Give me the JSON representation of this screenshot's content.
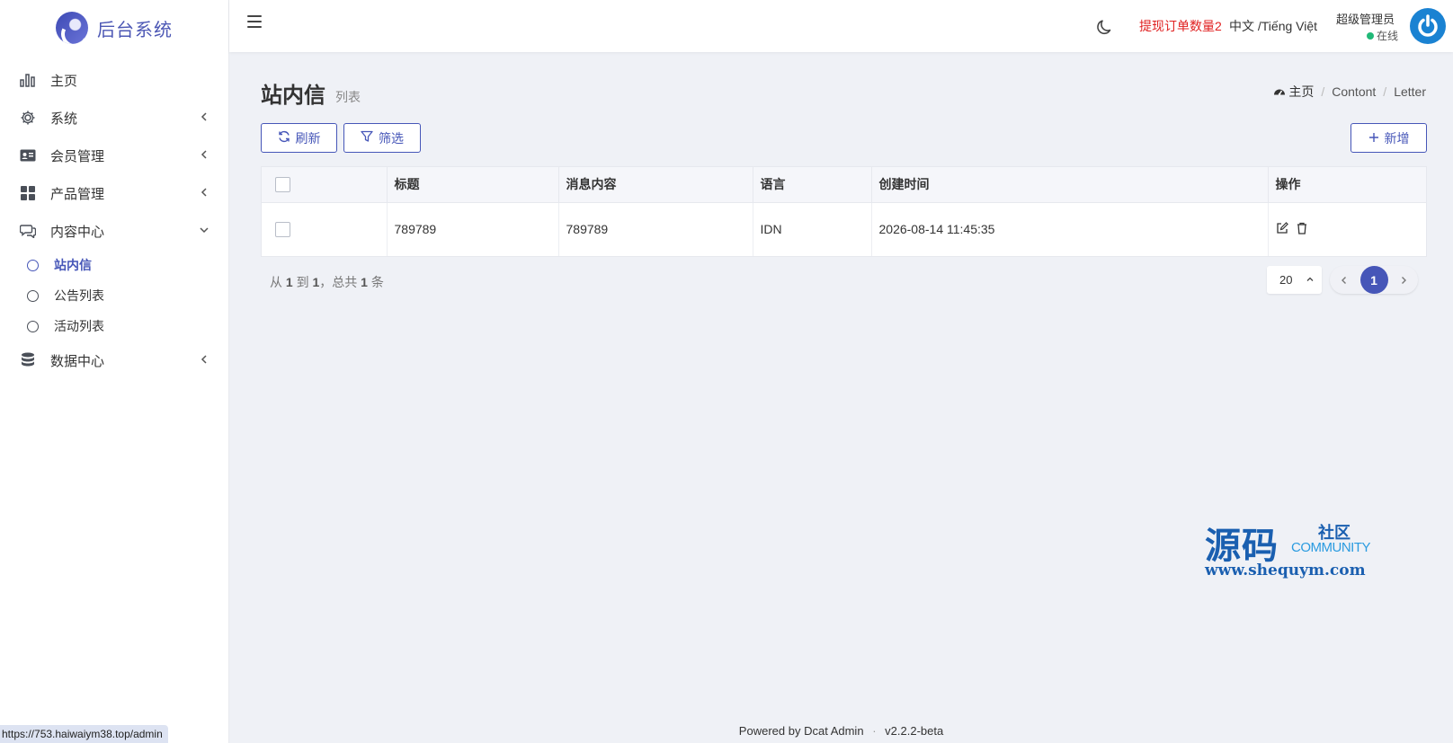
{
  "brand": {
    "title": "后台系统"
  },
  "sidebar": {
    "items": [
      {
        "label": "主页",
        "icon": "bar-chart-icon"
      },
      {
        "label": "系统",
        "icon": "gear-icon"
      },
      {
        "label": "会员管理",
        "icon": "id-card-icon"
      },
      {
        "label": "产品管理",
        "icon": "grid-icon"
      },
      {
        "label": "内容中心",
        "icon": "chat-icon"
      },
      {
        "label": "数据中心",
        "icon": "database-icon"
      }
    ],
    "sub_items": [
      {
        "label": "站内信"
      },
      {
        "label": "公告列表"
      },
      {
        "label": "活动列表"
      }
    ]
  },
  "status_bar": {
    "url": "https://753.haiwaiym38.top/admin"
  },
  "navbar": {
    "withdraw_text": "提现订单数量2",
    "language": "中文 /Tiếng Việt",
    "user_name": "超级管理员",
    "user_status": "在线"
  },
  "page": {
    "title": "站内信",
    "subtitle": "列表",
    "breadcrumb": {
      "home": "主页",
      "level1": "Contont",
      "level2": "Letter"
    }
  },
  "toolbar": {
    "refresh_label": "刷新",
    "filter_label": "筛选",
    "new_label": "新增"
  },
  "table": {
    "headers": {
      "title": "标题",
      "content": "消息内容",
      "language": "语言",
      "created": "创建时间",
      "actions": "操作"
    },
    "rows": [
      {
        "title": "789789",
        "content": "789789",
        "language": "IDN",
        "created": "2026-08-14 11:45:35"
      }
    ]
  },
  "pagination": {
    "from_label": "从",
    "from": "1",
    "to_label": "到",
    "to": "1",
    "total_label": "，总共",
    "total": "1",
    "unit": "条",
    "per_page": "20",
    "current_page": "1"
  },
  "watermark": {
    "cn_main": "源码",
    "cn_sub": "社区",
    "en": "COMMUNITY",
    "url": "www.shequym.com"
  },
  "footer": {
    "powered": "Powered by",
    "product": "Dcat Admin",
    "version": "v2.2.2-beta"
  },
  "colors": {
    "primary": "#4656b8",
    "danger": "#e02020",
    "online": "#21b978",
    "avatar": "#1a82d2"
  }
}
